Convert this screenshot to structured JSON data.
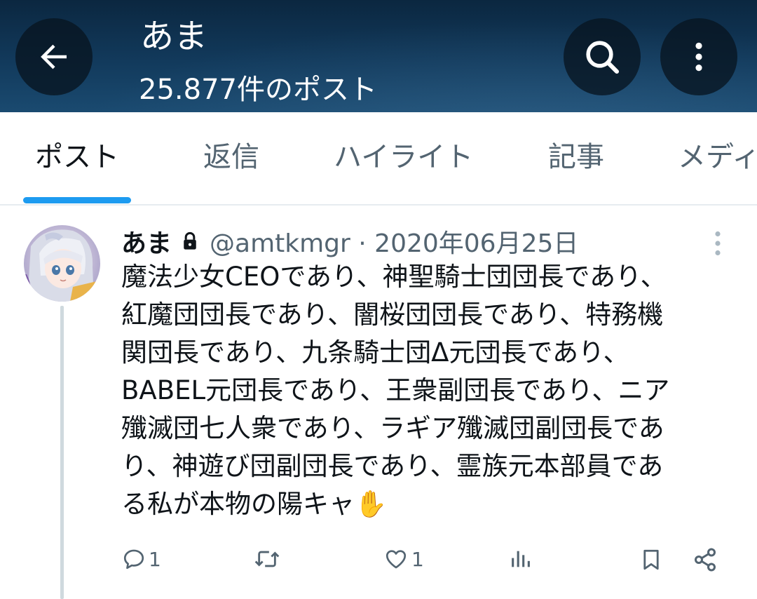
{
  "header": {
    "title": "あま",
    "subtitle": "25.877件のポスト"
  },
  "tabs": [
    {
      "label": "ポスト",
      "active": true
    },
    {
      "label": "返信",
      "active": false
    },
    {
      "label": "ハイライト",
      "active": false
    },
    {
      "label": "記事",
      "active": false
    },
    {
      "label": "メディ",
      "active": false
    }
  ],
  "post": {
    "display_name": "あま",
    "handle_and_date": "@amtkmgr · 2020年06月25日",
    "text": "魔法少女CEOであり、神聖騎士団団長であり、\n紅魔団団長であり、闇桜団団長であり、特務機\n関団長であり、九条騎士団Δ元団長であり、\nBABEL元団長であり、王衆副団長であり、ニア\n殲滅団七人衆であり、ラギア殲滅団副団長であ\nり、神遊び団副団長であり、霊族元本部員であ\nる私が本物の陽キャ✋",
    "replies": "1",
    "likes": "1"
  },
  "colors": {
    "accent": "#1d9bf0",
    "header_bg": "#123a5c",
    "secondary_text": "#536471"
  }
}
